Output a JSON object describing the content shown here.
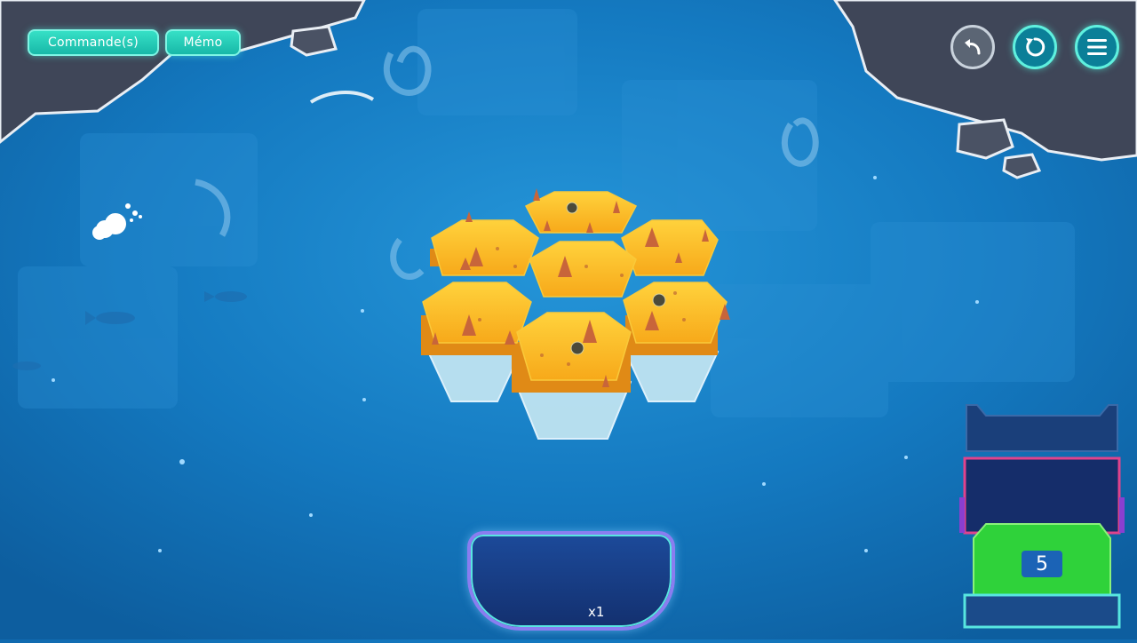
{
  "top_bar": {
    "commands_label": "Commande(s)",
    "memo_label": "Mémo"
  },
  "top_right_controls": [
    {
      "name": "back",
      "icon": "undo-arrow-icon"
    },
    {
      "name": "reset",
      "icon": "reset-circular-arrow-icon"
    },
    {
      "name": "menu",
      "icon": "hamburger-menu-icon"
    }
  ],
  "tray": {
    "tile_color": "#e23c78",
    "count_label": "x1",
    "icon": "grab-hand-icon"
  },
  "side_panel": {
    "level_number": "5",
    "active_color": "#2fd23a"
  },
  "colors": {
    "ocean": "#1479c0",
    "island_yellow": "#f7b21e",
    "rock_gray": "#3f4658",
    "accent_teal": "#36e0c6"
  }
}
